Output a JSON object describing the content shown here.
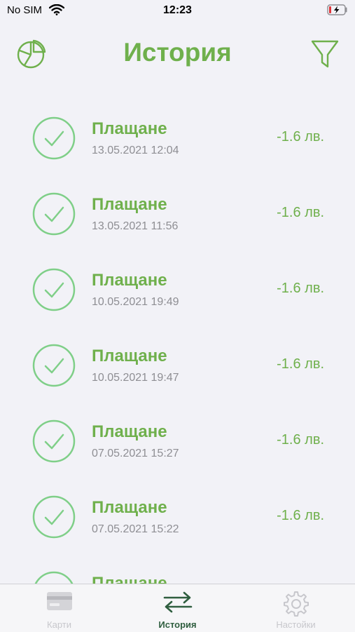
{
  "status": {
    "carrier": "No SIM",
    "time": "12:23"
  },
  "header": {
    "title": "История"
  },
  "colors": {
    "accent": "#6fb04c",
    "check_circle": "#7fcf88",
    "tab_active": "#2f5e3f",
    "tab_inactive": "#c7c7cc"
  },
  "transactions": [
    {
      "name": "Плащане",
      "date": "13.05.2021 12:04",
      "amount": "-1.6 лв."
    },
    {
      "name": "Плащане",
      "date": "13.05.2021 11:56",
      "amount": "-1.6 лв."
    },
    {
      "name": "Плащане",
      "date": "10.05.2021 19:49",
      "amount": "-1.6 лв."
    },
    {
      "name": "Плащане",
      "date": "10.05.2021 19:47",
      "amount": "-1.6 лв."
    },
    {
      "name": "Плащане",
      "date": "07.05.2021 15:27",
      "amount": "-1.6 лв."
    },
    {
      "name": "Плащане",
      "date": "07.05.2021 15:22",
      "amount": "-1.6 лв."
    },
    {
      "name": "Плащане",
      "date": "",
      "amount": ""
    }
  ],
  "tabs": [
    {
      "label": "Карти",
      "icon": "card-icon",
      "active": false
    },
    {
      "label": "История",
      "icon": "arrows-swap-icon",
      "active": true
    },
    {
      "label": "Настойки",
      "icon": "gear-icon",
      "active": false
    }
  ]
}
